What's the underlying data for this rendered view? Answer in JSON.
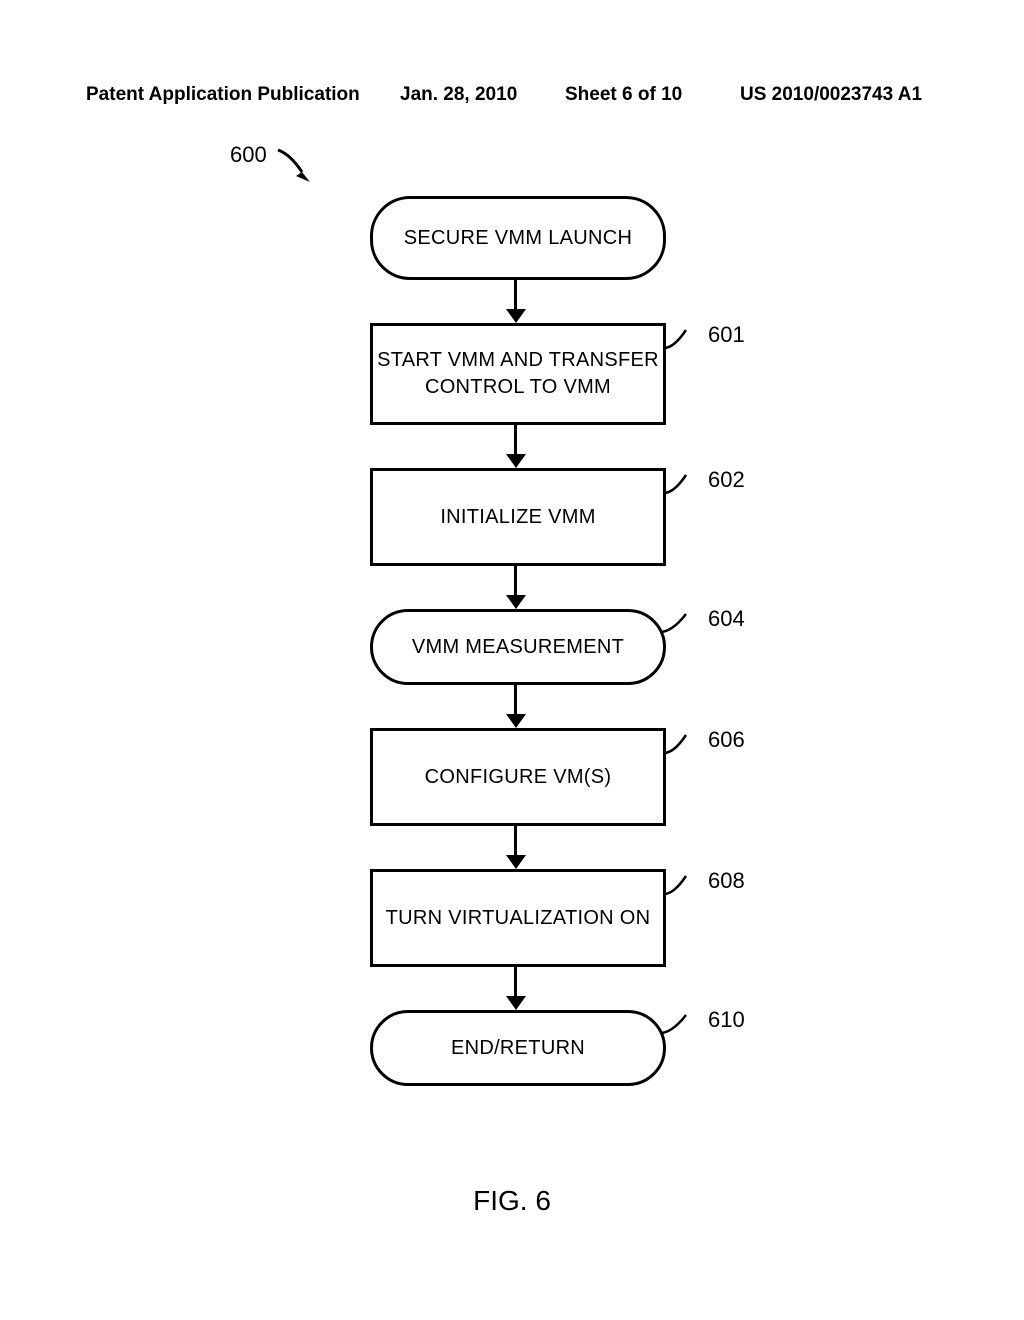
{
  "header": {
    "publication_label": "Patent Application Publication",
    "date": "Jan. 28, 2010",
    "sheet": "Sheet 6 of 10",
    "app_number": "US 2010/0023743 A1"
  },
  "flow": {
    "ref_overall": "600",
    "nodes": {
      "start": {
        "text": "SECURE VMM LAUNCH"
      },
      "step601": {
        "text": "START VMM AND TRANSFER\nCONTROL TO VMM",
        "ref": "601"
      },
      "step602": {
        "text": "INITIALIZE VMM",
        "ref": "602"
      },
      "step604": {
        "text": "VMM MEASUREMENT",
        "ref": "604"
      },
      "step606": {
        "text": "CONFIGURE VM(S)",
        "ref": "606"
      },
      "step608": {
        "text": "TURN VIRTUALIZATION ON",
        "ref": "608"
      },
      "end": {
        "text": "END/RETURN",
        "ref": "610"
      }
    }
  },
  "figure_caption": "FIG. 6"
}
